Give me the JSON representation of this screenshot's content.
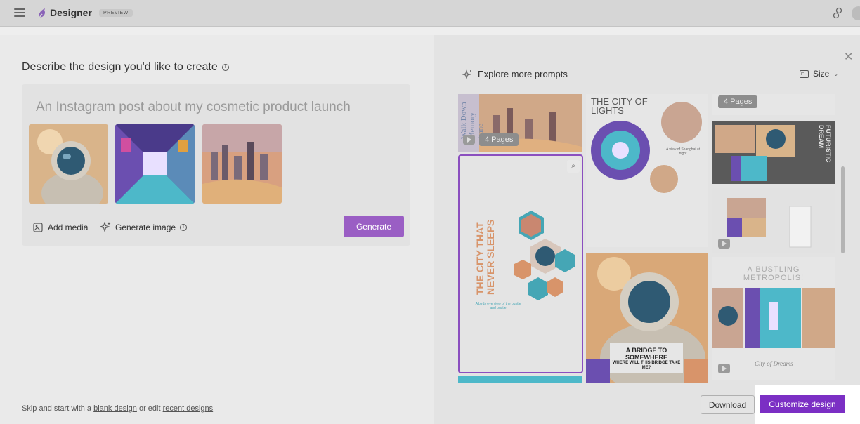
{
  "app": {
    "name": "Designer",
    "badge": "PREVIEW"
  },
  "left": {
    "heading": "Describe the design you'd like to create",
    "prompt_placeholder": "An Instagram post about my cosmetic product launch",
    "tools": {
      "add_media": "Add media",
      "generate_image": "Generate image"
    },
    "generate_label": "Generate",
    "skip": {
      "prefix": "Skip and start with a",
      "blank": "blank design",
      "middle": "or edit",
      "recent": "recent designs"
    }
  },
  "right": {
    "explore_label": "Explore more prompts",
    "size_label": "Size",
    "tiles": {
      "t1_title": "Walk Down Memory Lane",
      "t1_pages": "4 Pages",
      "t2_title": "THE CITY OF LIGHTS",
      "t2_caption": "A view of Shanghai at night",
      "t3_pages": "4 Pages",
      "t4_title": "FUTURISTIC DREAM",
      "sel_title": "THE CITY THAT NEVER SLEEPS",
      "sel_caption": "A birds eye view of the bustle and bustle",
      "bridge_title": "A BRIDGE TO SOMEWHERE",
      "bridge_sub": "WHERE WILL THIS BRIDGE TAKE ME?",
      "metro_title": "A BUSTLING METROPOLIS!",
      "metro_caption": "City of Dreams"
    },
    "download_label": "Download",
    "customize_label": "Customize design"
  },
  "colors": {
    "accent": "#7b2fc4",
    "generate": "#9a5ec4"
  }
}
